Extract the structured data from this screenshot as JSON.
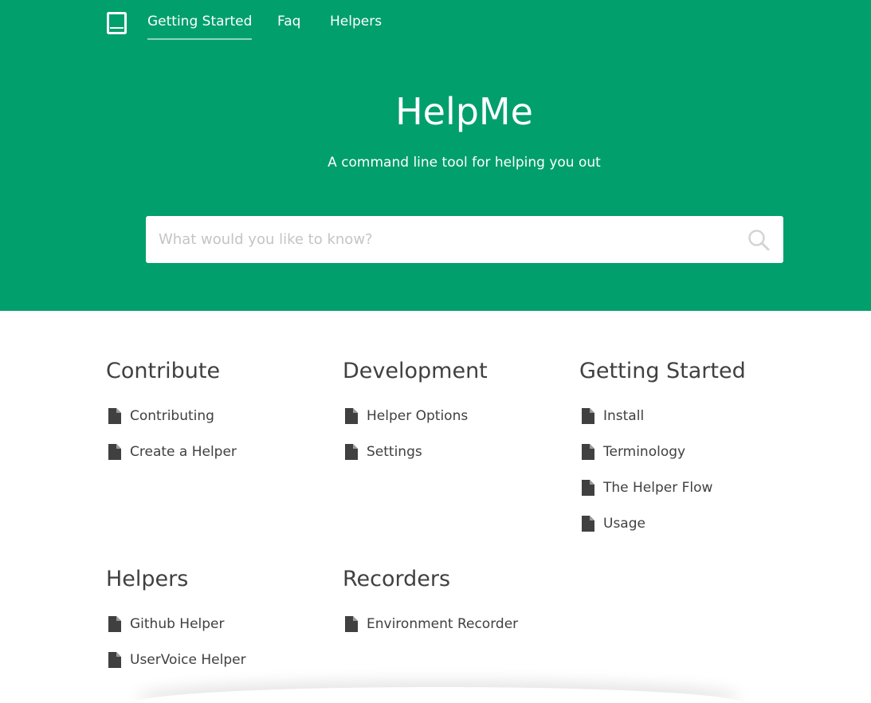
{
  "colors": {
    "brand": "#009f6b",
    "text": "#404040",
    "background": "#ffffff"
  },
  "header": {
    "logo_icon": "book-icon",
    "nav": [
      {
        "label": "Getting Started",
        "active": true
      },
      {
        "label": "Faq",
        "active": false
      },
      {
        "label": "Helpers",
        "active": false
      }
    ]
  },
  "hero": {
    "title": "HelpMe",
    "tagline": "A command line tool for helping you out"
  },
  "search": {
    "placeholder": "What would you like to know?",
    "value": "",
    "icon": "search-icon"
  },
  "categories": [
    {
      "title": "Contribute",
      "articles": [
        "Contributing",
        "Create a Helper"
      ]
    },
    {
      "title": "Development",
      "articles": [
        "Helper Options",
        "Settings"
      ]
    },
    {
      "title": "Getting Started",
      "articles": [
        "Install",
        "Terminology",
        "The Helper Flow",
        "Usage"
      ]
    },
    {
      "title": "Helpers",
      "articles": [
        "Github Helper",
        "UserVoice Helper"
      ]
    },
    {
      "title": "Recorders",
      "articles": [
        "Environment Recorder"
      ]
    }
  ],
  "article_icon": "document-icon"
}
